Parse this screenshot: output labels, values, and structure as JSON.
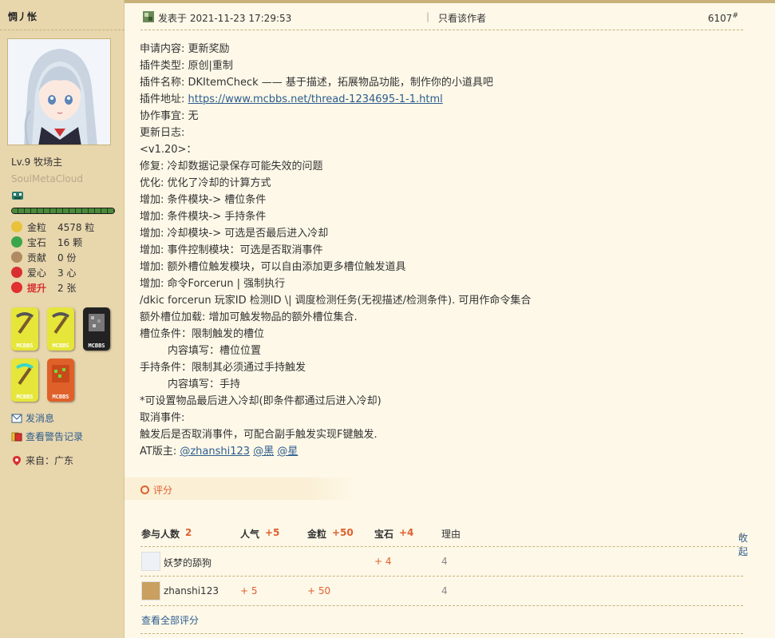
{
  "user": {
    "name": "惆丿怅",
    "level": "Lv.9 牧场主",
    "subtitle": "SoulMetaCloud",
    "progress_fraction": 1.0,
    "stats": [
      {
        "label": "金粒",
        "value": "4578 粒",
        "color": "#e8c23a"
      },
      {
        "label": "宝石",
        "value": "16 颗",
        "color": "#3aa54a"
      },
      {
        "label": "贡献",
        "value": "0 份",
        "color": "#b08a60"
      },
      {
        "label": "爱心",
        "value": "3 心",
        "color": "#d83030"
      },
      {
        "label": "提升",
        "value": "2 张",
        "color": "#e03030"
      }
    ],
    "badges": [
      {
        "text": "MCBBS",
        "icon": "pickaxe-badge-icon",
        "color": "#e6e63a"
      },
      {
        "text": "MCBBS",
        "icon": "pickaxe-badge-icon",
        "color": "#e6e63a"
      },
      {
        "text": "MCBBS",
        "icon": "ore-badge-icon",
        "color": "#222222"
      },
      {
        "text": "MCBBS",
        "icon": "diamond-pickaxe-badge-icon",
        "color": "#e6e63a"
      },
      {
        "text": "MCBBS",
        "icon": "redstone-badge-icon",
        "color": "#e0602a"
      }
    ],
    "links": {
      "message": "发消息",
      "warnings": "查看警告记录"
    },
    "from": "来自：广东"
  },
  "post": {
    "posted_at": "发表于 2021-11-23 17:29:53",
    "separator": "|",
    "only_author": "只看该作者",
    "floor": "6107",
    "floor_mark": "#",
    "lines": [
      {
        "text": "申请内容: 更新奖励"
      },
      {
        "text": "插件类型: 原创|重制"
      },
      {
        "text": "插件名称: DKItemCheck —— 基于描述，拓展物品功能，制作你的小道具吧"
      },
      {
        "prefix": "插件地址: ",
        "link": "https://www.mcbbs.net/thread-1234695-1-1.html"
      },
      {
        "text": "协作事宜: 无"
      },
      {
        "text": "更新日志:"
      },
      {
        "text": "<v1.20>："
      },
      {
        "text": "修复: 冷却数据记录保存可能失效的问题"
      },
      {
        "text": "优化: 优化了冷却的计算方式"
      },
      {
        "text": "增加: 条件模块-> 槽位条件"
      },
      {
        "text": "增加: 条件模块-> 手持条件"
      },
      {
        "text": "增加: 冷却模块-> 可选是否最后进入冷却"
      },
      {
        "text": "增加: 事件控制模块：可选是否取消事件"
      },
      {
        "text": "增加: 额外槽位触发模块，可以自由添加更多槽位触发道具"
      },
      {
        "text": "增加: 命令Forcerun | 强制执行"
      },
      {
        "text": "/dkic forcerun 玩家ID 检测ID \\| 调度检测任务(无视描述/检测条件). 可用作命令集合"
      },
      {
        "text": "额外槽位加载: 增加可触发物品的额外槽位集合."
      },
      {
        "text": "槽位条件：限制触发的槽位"
      },
      {
        "text": "内容填写：槽位位置",
        "indent": true
      },
      {
        "text": "手持条件：限制其必须通过手持触发"
      },
      {
        "text": "内容填写：手持",
        "indent": true
      },
      {
        "text": "*可设置物品最后进入冷却(即条件都通过后进入冷却)"
      },
      {
        "text": "取消事件:"
      },
      {
        "text": "触发后是否取消事件，可配合副手触发实现F键触发."
      },
      {
        "prefix": "AT版主: ",
        "mentions": [
          "@zhanshi123",
          "@黑",
          "@星"
        ]
      }
    ]
  },
  "rating": {
    "label": "评分",
    "header": {
      "participants_label": "参与人数",
      "participants_value": "2",
      "popularity_label": "人气",
      "popularity_value": "+5",
      "gold_label": "金粒",
      "gold_value": "+50",
      "gem_label": "宝石",
      "gem_value": "+4",
      "reason_label": "理由",
      "collapse": "收起"
    },
    "rows": [
      {
        "name": "妖梦的舔狗",
        "popularity": "",
        "gold": "",
        "gem": "+ 4",
        "reason": "4"
      },
      {
        "name": "zhanshi123",
        "popularity": "+ 5",
        "gold": "+ 50",
        "gem": "",
        "reason": "4"
      }
    ],
    "view_all": "查看全部评分"
  },
  "colors": {
    "sidebar_bg": "#e8d6ad",
    "page_bg": "#fdf8e8",
    "link": "#2d5d8e",
    "accent": "#e0602f"
  }
}
